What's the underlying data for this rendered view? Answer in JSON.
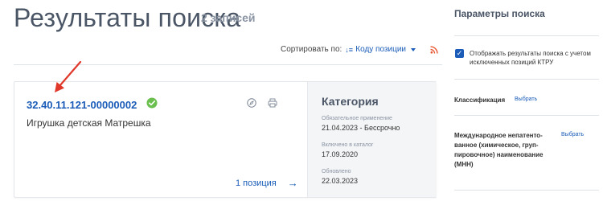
{
  "main": {
    "title": "Результаты поиска",
    "count": "2 записей",
    "sort": {
      "label": "Сортировать по:",
      "value": "Коду позиции"
    }
  },
  "card": {
    "code": "32.40.11.121-00000002",
    "name": "Игрушка детская Матрешка",
    "positions": "1 позиция",
    "category": {
      "title": "Категория",
      "mandatory_label": "Обязательное применение",
      "mandatory_value": "21.04.2023  - Бессрочно",
      "included_label": "Включено в каталог",
      "included_value": "17.09.2020",
      "updated_label": "Обновлено",
      "updated_value": "22.03.2023"
    }
  },
  "sidebar": {
    "title": "Параметры поиска",
    "checkbox_label": "Отображать результаты поиска с учетом исключенных позиций КТРУ",
    "classification_label": "Классификация",
    "classification_select": "Выбрать",
    "mnn_label": "Международное непатенто-ванное (химическое, груп-пировочное) наименование (МНН)",
    "mnn_select": "Выбрать"
  },
  "colors": {
    "accent": "#1a5cb8",
    "ok": "#6bbf4e",
    "arrow": "#e0392b",
    "rss": "#e8502a"
  }
}
